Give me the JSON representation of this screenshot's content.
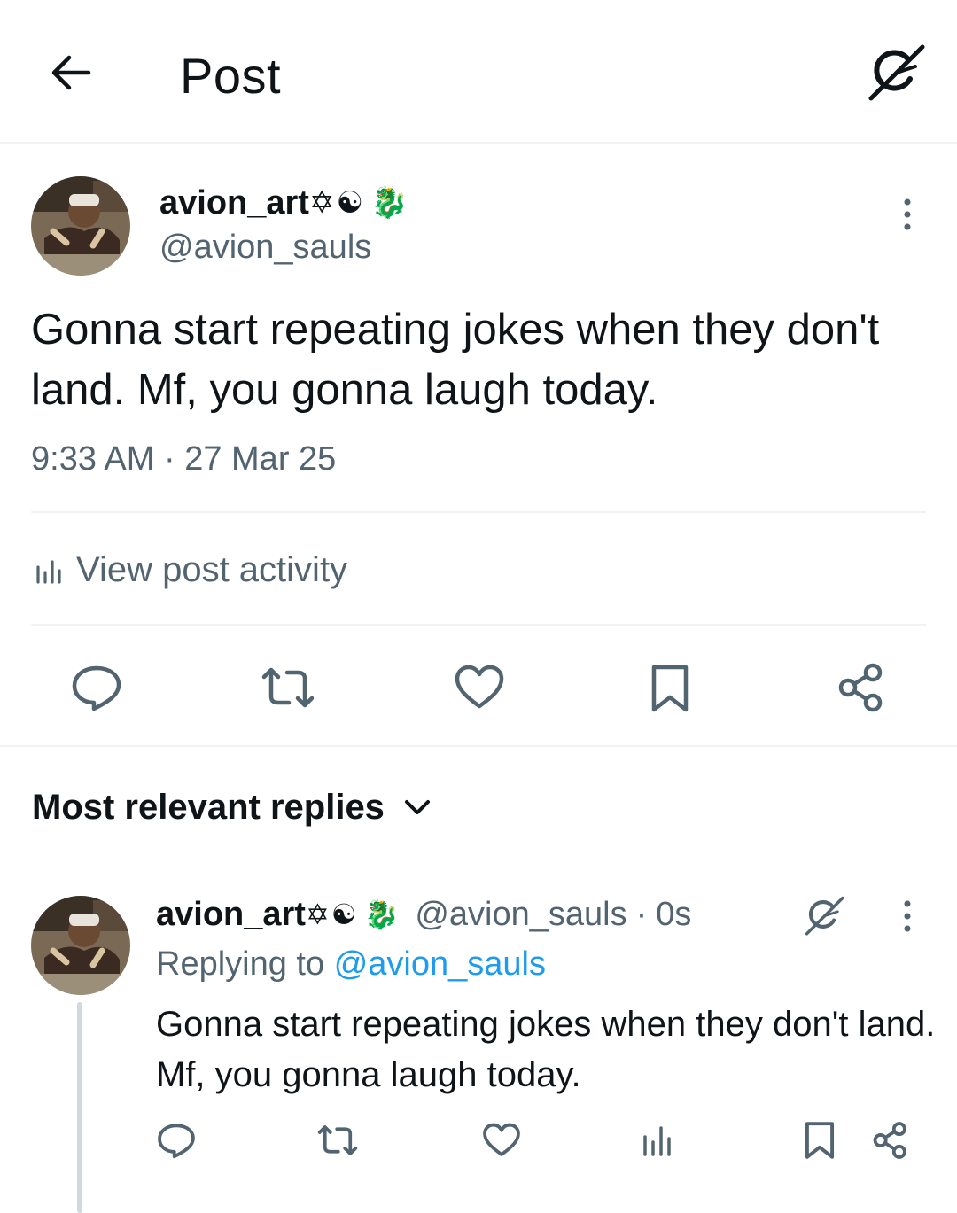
{
  "header": {
    "title": "Post",
    "back_icon": "arrow-left-icon",
    "grok_icon": "grok-icon"
  },
  "post": {
    "display_name": "avion_art",
    "name_emojis": [
      "✡",
      "☯",
      "🐉"
    ],
    "handle": "@avion_sauls",
    "text": "Gonna start repeating jokes when they don't land. Mf, you gonna laugh today.",
    "time": "9:33 AM",
    "date": "27 Mar 25",
    "activity_label": "View post activity",
    "actions": [
      "reply-icon",
      "repost-icon",
      "like-icon",
      "bookmark-icon",
      "share-icon"
    ]
  },
  "replies_section": {
    "title": "Most relevant replies"
  },
  "reply": {
    "display_name": "avion_art",
    "name_emojis": [
      "✡",
      "☯",
      "🐉"
    ],
    "handle": "@avion_sauls",
    "separator": "·",
    "time": "0s",
    "replying_to_label": "Replying to",
    "replying_to_handle": "@avion_sauls",
    "text": "Gonna start repeating jokes when they don't land. Mf, you gonna laugh today.",
    "actions": [
      "reply-icon",
      "repost-icon",
      "like-icon",
      "views-icon",
      "bookmark-icon",
      "share-icon"
    ]
  },
  "colors": {
    "text": "#0f1419",
    "secondary": "#536471",
    "link": "#1d9bf0",
    "divider": "#eff3f4"
  }
}
